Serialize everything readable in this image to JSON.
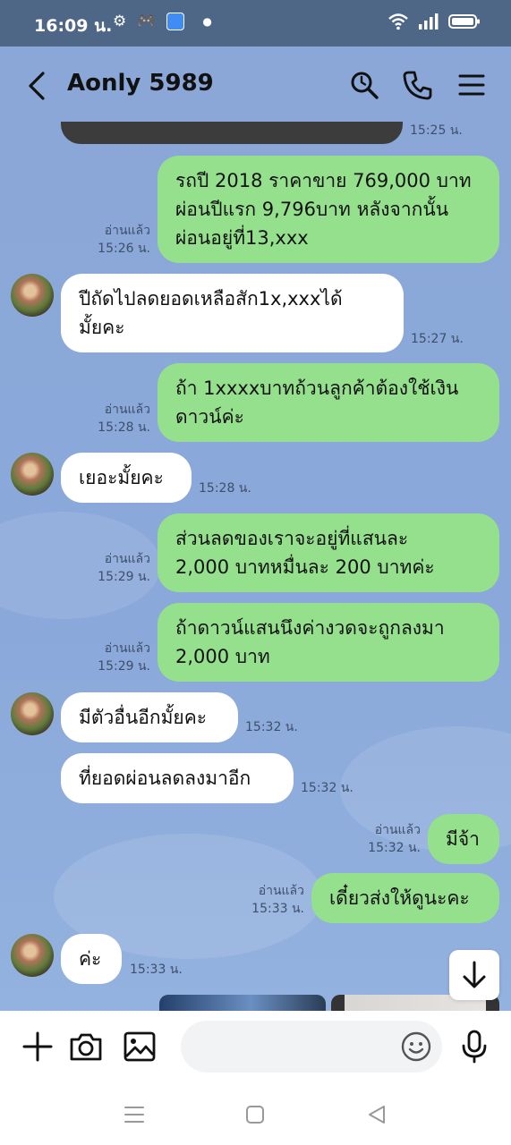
{
  "status_bar": {
    "time": "16:09 น."
  },
  "header": {
    "title": "Aonly 5989"
  },
  "message_field": {
    "placeholder": ""
  },
  "colors": {
    "outgoing_bubble": "#95e08c",
    "incoming_bubble": "#ffffff",
    "chat_background": "#8aa7d8",
    "status_bar": "#4f6786"
  },
  "messages": [
    {
      "side": "image",
      "time": "15:25 น."
    },
    {
      "side": "me",
      "text": "รถปี 2018 ราคาขาย 769,000 บาท\nผ่อนปีแรก 9,796บาท หลังจากนั้น\nผ่อนอยู่ที่13,xxx",
      "read": "อ่านแล้ว",
      "time": "15:26 น."
    },
    {
      "side": "them",
      "text": "ปีถัดไปลดยอดเหลือสัก1x,xxxได้\nมั้ยคะ",
      "time": "15:27 น."
    },
    {
      "side": "me",
      "text": "ถ้า 1xxxxบาทถ้วนลูกค้าต้องใช้เงิน\nดาวน์ค่ะ",
      "read": "อ่านแล้ว",
      "time": "15:28 น."
    },
    {
      "side": "them",
      "text": "เยอะมั้ยคะ",
      "time": "15:28 น."
    },
    {
      "side": "me",
      "text": "ส่วนลดของเราจะอยู่ที่แสนละ\n2,000 บาทหมื่นละ 200 บาทค่ะ",
      "read": "อ่านแล้ว",
      "time": "15:29 น."
    },
    {
      "side": "me",
      "text": "ถ้าดาวน์แสนนึงค่างวดจะถูกลงมา\n2,000 บาท",
      "read": "อ่านแล้ว",
      "time": "15:29 น."
    },
    {
      "side": "them",
      "text": "มีตัวอื่นอีกมั้ยคะ",
      "time": "15:32 น."
    },
    {
      "side": "them",
      "text": "ที่ยอดผ่อนลดลงมาอีก",
      "time": "15:32 น."
    },
    {
      "side": "me",
      "text": "มีจ้า",
      "read": "อ่านแล้ว",
      "time": "15:32 น."
    },
    {
      "side": "me",
      "text": "เดี๋ยวส่งให้ดูนะคะ",
      "read": "อ่านแล้ว",
      "time": "15:33 น."
    },
    {
      "side": "them",
      "text": "ค่ะ",
      "time": "15:33 น."
    }
  ]
}
